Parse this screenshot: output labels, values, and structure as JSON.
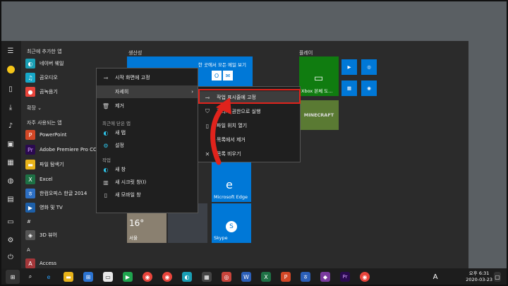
{
  "applist": {
    "recent_header": "최근에 추가한 앱",
    "recent": [
      "네이버 웨일",
      "곰오디오",
      "곰녹음기"
    ],
    "expand_label": "확장",
    "frequent_header": "자주 사용되는 앱",
    "frequent": [
      "PowerPoint",
      "Adobe Premiere Pro CC 2",
      "파일 탐색기",
      "Excel",
      "한컴오피스 한글 2014",
      "영화 및 TV"
    ],
    "hash_letter": "#",
    "hash_app": "3D 뷰어",
    "a_letter": "A",
    "a_app": "Access"
  },
  "groups": {
    "productivity": "생산성",
    "play": "플레이"
  },
  "tiles": {
    "header_text": "한 곳에서 모든 메일 보기",
    "edge": "Microsoft Edge",
    "skype": "Skype",
    "weather_temp": "16°",
    "weather_city": "서울",
    "xbox": "Xbox 본체 도...",
    "minecraft": "MINECRAFT"
  },
  "context_menu": {
    "pin_start": "시작 화면에 고정",
    "more": "자세히",
    "uninstall": "제거",
    "recent_header": "최근에 닫은 앱",
    "recent": [
      "새 탭",
      "설정"
    ],
    "tasks_header": "작업",
    "tasks": [
      "새 창",
      "새 시크릿 창(I)",
      "새 모바일 창"
    ]
  },
  "submenu": {
    "items": [
      "작업 표시줄에 고정",
      "관리자 권한으로 실행",
      "파일 위치 열기",
      "목록에서 제거",
      "목록 비우기"
    ]
  },
  "clock": {
    "time": "오후 6:31",
    "date": "2020-03-23"
  },
  "ime": "A",
  "colors": {
    "tile_blue": "#0078d7",
    "tile_green": "#107c10",
    "highlight_red": "#e0231c"
  }
}
